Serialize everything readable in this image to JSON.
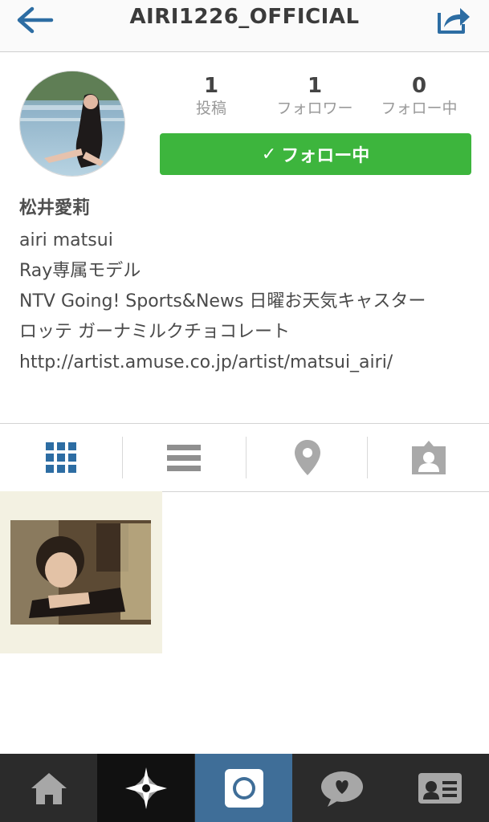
{
  "header": {
    "title": "AIRI1226_OFFICIAL",
    "back_icon": "back-arrow-icon",
    "share_icon": "share-icon"
  },
  "profile": {
    "stats": [
      {
        "value": "1",
        "label": "投稿"
      },
      {
        "value": "1",
        "label": "フォロワー"
      },
      {
        "value": "0",
        "label": "フォロー中"
      }
    ],
    "follow_button": {
      "check": "✓",
      "label": "フォロー中"
    },
    "name": "松井愛莉",
    "bio_lines": [
      "airi matsui",
      "Ray専属モデル",
      "NTV Going! Sports&News 日曜お天気キャスター",
      "ロッテ ガーナミルクチョコレート"
    ],
    "link": "http://artist.amuse.co.jp/artist/matsui_airi/"
  },
  "tabs": {
    "icons": [
      "grid-icon",
      "list-icon",
      "location-pin-icon",
      "tagged-person-icon"
    ],
    "selected": "grid-icon"
  },
  "bottom_nav": {
    "icons": [
      "home-icon",
      "explore-star-icon",
      "camera-icon",
      "activity-heart-icon",
      "profile-card-icon"
    ],
    "selected": "camera-icon"
  },
  "colors": {
    "accent_blue": "#2d6da3",
    "follow_green": "#3db53d",
    "bottom_bar": "#2b2b2b",
    "selected_nav": "#3f6e98"
  }
}
